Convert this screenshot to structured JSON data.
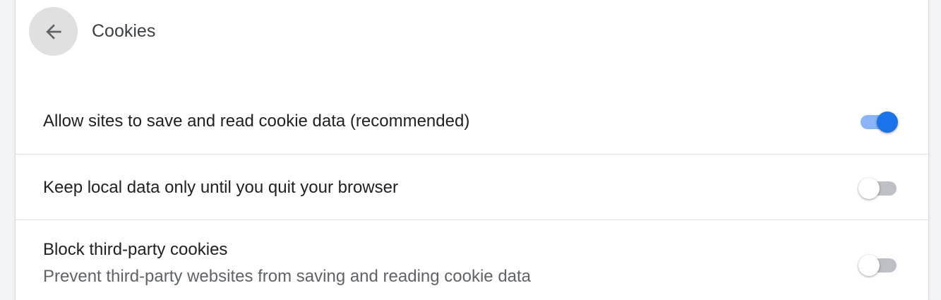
{
  "header": {
    "title": "Cookies",
    "back_icon": "arrow-back-icon"
  },
  "settings": [
    {
      "label": "Allow sites to save and read cookie data (recommended)",
      "enabled": true
    },
    {
      "label": "Keep local data only until you quit your browser",
      "enabled": false
    },
    {
      "label": "Block third-party cookies",
      "sublabel": "Prevent third-party websites from saving and reading cookie data",
      "enabled": false
    }
  ],
  "colors": {
    "accent": "#1a73e8",
    "accent_track": "#8ab4f8",
    "off_track": "#bdc1c6"
  }
}
